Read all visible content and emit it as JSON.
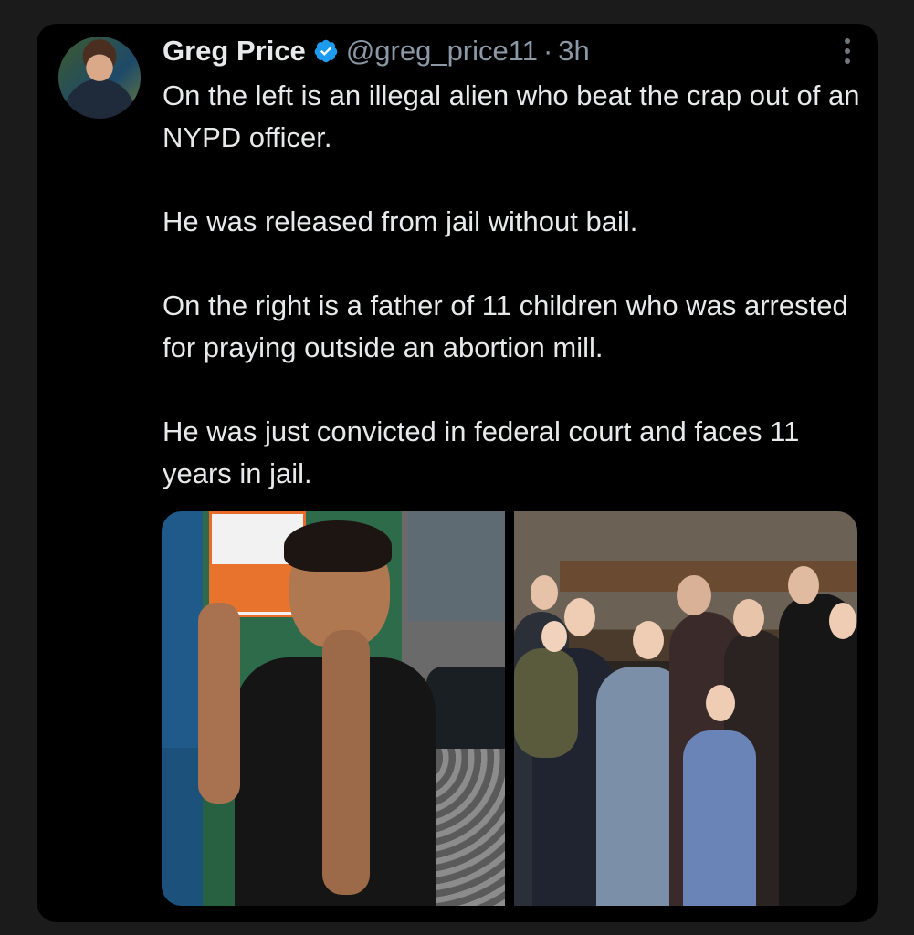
{
  "tweet": {
    "author_name": "Greg Price",
    "handle": "@greg_price11",
    "separator": "·",
    "time": "3h",
    "paragraphs": [
      "On the left is an illegal alien who beat the crap out of an NYPD officer.",
      "He was released from jail without bail.",
      "On the right is a father of 11 children who was arrested for praying outside an abortion mill.",
      "He was just convicted in federal court and faces 11 years in jail."
    ]
  },
  "icons": {
    "verified": "verified-badge-icon",
    "more": "more-options-icon"
  },
  "colors": {
    "background": "#000000",
    "text": "#e7e9ea",
    "secondary_text": "#8b98a5",
    "verified_blue": "#1d9bf0"
  }
}
